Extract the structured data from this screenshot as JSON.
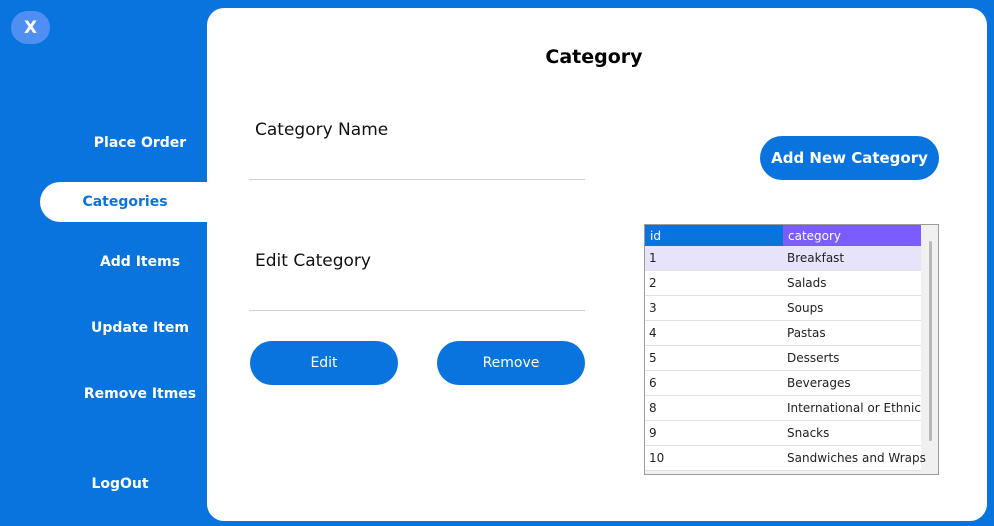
{
  "window": {
    "close_label": "X"
  },
  "sidebar": {
    "items": [
      {
        "label": "Place Order",
        "active": false
      },
      {
        "label": "Categories",
        "active": true
      },
      {
        "label": "Add Items",
        "active": false
      },
      {
        "label": "Update Item",
        "active": false
      },
      {
        "label": "Remove Itmes",
        "active": false
      }
    ],
    "logout_label": "LogOut"
  },
  "main": {
    "title": "Category",
    "category_name_label": "Category Name",
    "category_name_value": "",
    "edit_category_label": "Edit Category",
    "edit_category_value": "",
    "edit_button": "Edit",
    "remove_button": "Remove",
    "add_new_button": "Add New Category"
  },
  "table": {
    "columns": [
      "id",
      "category"
    ],
    "rows": [
      {
        "id": "1",
        "category": "Breakfast"
      },
      {
        "id": "2",
        "category": "Salads"
      },
      {
        "id": "3",
        "category": "Soups"
      },
      {
        "id": "4",
        "category": "Pastas"
      },
      {
        "id": "5",
        "category": "Desserts"
      },
      {
        "id": "6",
        "category": "Beverages"
      },
      {
        "id": "8",
        "category": "International or Ethnic"
      },
      {
        "id": "9",
        "category": "Snacks"
      },
      {
        "id": "10",
        "category": "Sandwiches and Wraps"
      }
    ],
    "selected_index": 0
  },
  "colors": {
    "accent": "#0a74de",
    "header_secondary": "#7a5cff",
    "selected_row": "#e6e3fb"
  }
}
